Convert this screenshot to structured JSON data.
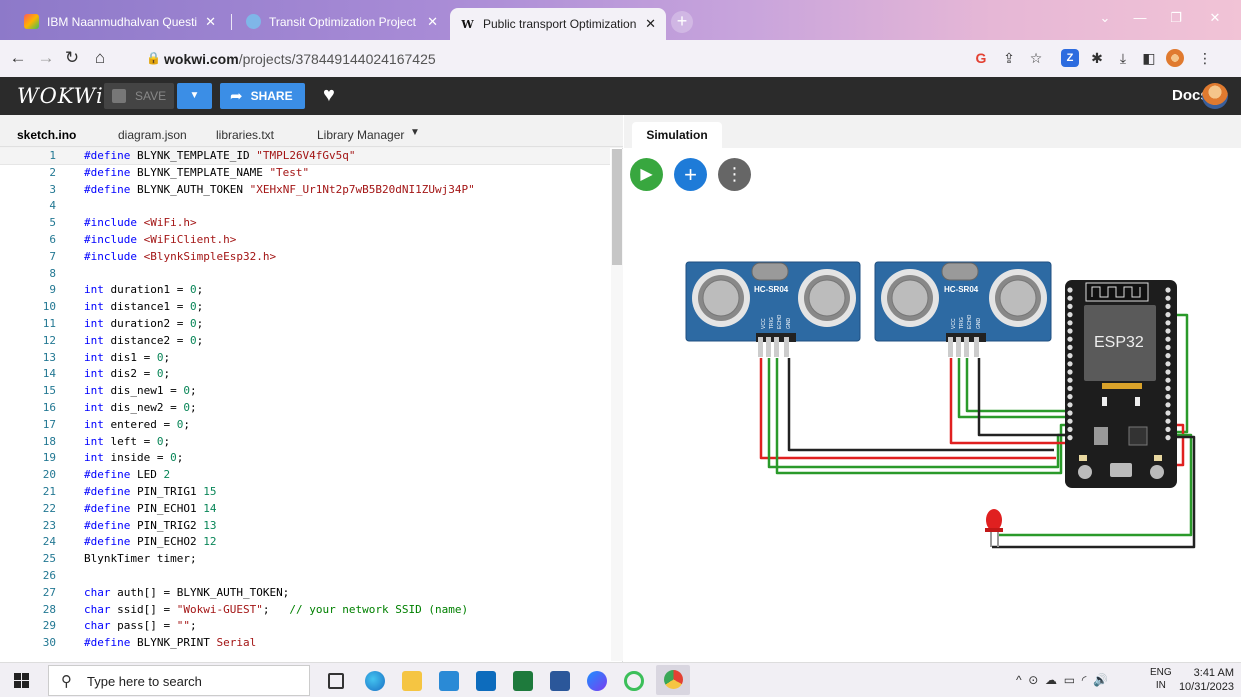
{
  "browser": {
    "tabs": [
      {
        "label": "IBM Naanmudhalvan Question I",
        "icon": "colorful-favicon-icon"
      },
      {
        "label": "Transit Optimization Project",
        "icon": "globe-favicon-icon"
      },
      {
        "label": "Public transport Optimization Pr",
        "icon": "w-favicon-icon",
        "favicon_letter": "W"
      }
    ],
    "new_tab": "+",
    "url_host": "wokwi.com",
    "url_path": "/projects/378449144024167425"
  },
  "header": {
    "logo": "WOKWi",
    "save_label": "SAVE",
    "share_label": "SHARE",
    "docs_label": "Docs"
  },
  "editor": {
    "tabs": [
      "sketch.ino",
      "diagram.json",
      "libraries.txt",
      "Library Manager"
    ],
    "lines": [
      [
        [
          "pp",
          "#define"
        ],
        [
          "t",
          " BLYNK_TEMPLATE_ID "
        ],
        [
          "str",
          "\"TMPL26V4fGv5q\""
        ]
      ],
      [
        [
          "pp",
          "#define"
        ],
        [
          "t",
          " BLYNK_TEMPLATE_NAME "
        ],
        [
          "str",
          "\"Test\""
        ]
      ],
      [
        [
          "pp",
          "#define"
        ],
        [
          "t",
          " BLYNK_AUTH_TOKEN "
        ],
        [
          "str",
          "\"XEHxNF_Ur1Nt2p7wB5B20dNI1ZUwj34P\""
        ]
      ],
      [],
      [
        [
          "pp",
          "#include"
        ],
        [
          "t",
          " "
        ],
        [
          "inc",
          "<WiFi.h>"
        ]
      ],
      [
        [
          "pp",
          "#include"
        ],
        [
          "t",
          " "
        ],
        [
          "inc",
          "<WiFiClient.h>"
        ]
      ],
      [
        [
          "pp",
          "#include"
        ],
        [
          "t",
          " "
        ],
        [
          "inc",
          "<BlynkSimpleEsp32.h>"
        ]
      ],
      [],
      [
        [
          "ty",
          "int"
        ],
        [
          "t",
          " duration1 = "
        ],
        [
          "num",
          "0"
        ],
        [
          "t",
          ";"
        ]
      ],
      [
        [
          "ty",
          "int"
        ],
        [
          "t",
          " distance1 = "
        ],
        [
          "num",
          "0"
        ],
        [
          "t",
          ";"
        ]
      ],
      [
        [
          "ty",
          "int"
        ],
        [
          "t",
          " duration2 = "
        ],
        [
          "num",
          "0"
        ],
        [
          "t",
          ";"
        ]
      ],
      [
        [
          "ty",
          "int"
        ],
        [
          "t",
          " distance2 = "
        ],
        [
          "num",
          "0"
        ],
        [
          "t",
          ";"
        ]
      ],
      [
        [
          "ty",
          "int"
        ],
        [
          "t",
          " dis1 = "
        ],
        [
          "num",
          "0"
        ],
        [
          "t",
          ";"
        ]
      ],
      [
        [
          "ty",
          "int"
        ],
        [
          "t",
          " dis2 = "
        ],
        [
          "num",
          "0"
        ],
        [
          "t",
          ";"
        ]
      ],
      [
        [
          "ty",
          "int"
        ],
        [
          "t",
          " dis_new1 = "
        ],
        [
          "num",
          "0"
        ],
        [
          "t",
          ";"
        ]
      ],
      [
        [
          "ty",
          "int"
        ],
        [
          "t",
          " dis_new2 = "
        ],
        [
          "num",
          "0"
        ],
        [
          "t",
          ";"
        ]
      ],
      [
        [
          "ty",
          "int"
        ],
        [
          "t",
          " entered = "
        ],
        [
          "num",
          "0"
        ],
        [
          "t",
          ";"
        ]
      ],
      [
        [
          "ty",
          "int"
        ],
        [
          "t",
          " left = "
        ],
        [
          "num",
          "0"
        ],
        [
          "t",
          ";"
        ]
      ],
      [
        [
          "ty",
          "int"
        ],
        [
          "t",
          " inside = "
        ],
        [
          "num",
          "0"
        ],
        [
          "t",
          ";"
        ]
      ],
      [
        [
          "pp",
          "#define"
        ],
        [
          "t",
          " LED "
        ],
        [
          "num",
          "2"
        ]
      ],
      [
        [
          "pp",
          "#define"
        ],
        [
          "t",
          " PIN_TRIG1 "
        ],
        [
          "num",
          "15"
        ]
      ],
      [
        [
          "pp",
          "#define"
        ],
        [
          "t",
          " PIN_ECHO1 "
        ],
        [
          "num",
          "14"
        ]
      ],
      [
        [
          "pp",
          "#define"
        ],
        [
          "t",
          " PIN_TRIG2 "
        ],
        [
          "num",
          "13"
        ]
      ],
      [
        [
          "pp",
          "#define"
        ],
        [
          "t",
          " PIN_ECHO2 "
        ],
        [
          "num",
          "12"
        ]
      ],
      [
        [
          "t",
          "BlynkTimer timer;"
        ]
      ],
      [],
      [
        [
          "ty",
          "char"
        ],
        [
          "t",
          " auth[] = BLYNK_AUTH_TOKEN;"
        ]
      ],
      [
        [
          "ty",
          "char"
        ],
        [
          "t",
          " ssid[] = "
        ],
        [
          "str",
          "\"Wokwi-GUEST\""
        ],
        [
          "t",
          ";   "
        ],
        [
          "cmt",
          "// your network SSID (name)"
        ]
      ],
      [
        [
          "ty",
          "char"
        ],
        [
          "t",
          " pass[] = "
        ],
        [
          "str",
          "\"\""
        ],
        [
          "t",
          ";"
        ]
      ],
      [
        [
          "pp",
          "#define"
        ],
        [
          "t",
          " BLYNK_PRINT "
        ],
        [
          "str",
          "Serial"
        ]
      ]
    ]
  },
  "simulation": {
    "tab_label": "Simulation",
    "sensor_label": "HC-SR04",
    "sensor_pins": [
      "VCC",
      "TRIG",
      "ECHO",
      "GND"
    ],
    "board_label": "ESP32"
  },
  "taskbar": {
    "search_placeholder": "Type here to search",
    "lang_line1": "ENG",
    "lang_line2": "IN",
    "time": "3:41 AM",
    "date": "10/31/2023"
  },
  "colors": {
    "wokwi_header": "#2b2b2b",
    "accent_blue": "#3b8ee6",
    "play_green": "#38a73f",
    "sensor_blue": "#2d6aa3",
    "wire_red": "#e02020",
    "wire_green": "#2a9a2a",
    "wire_black": "#222222"
  }
}
